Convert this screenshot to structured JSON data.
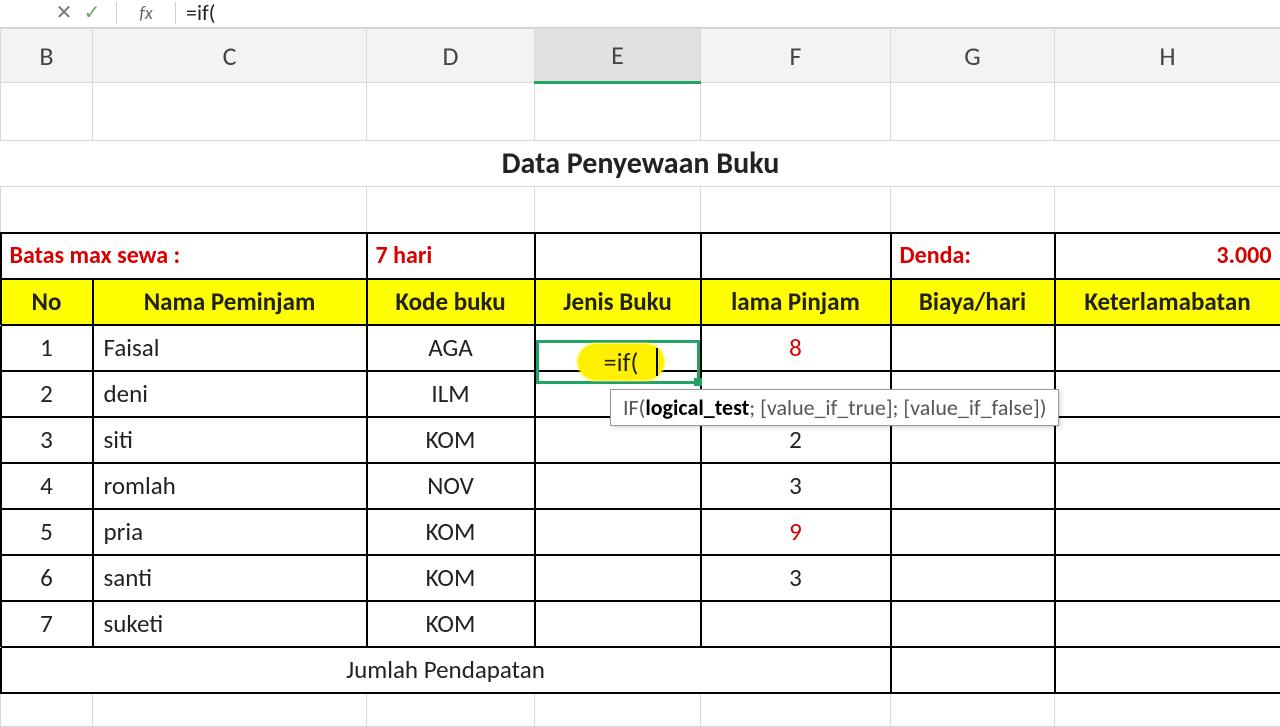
{
  "formula_bar": {
    "cancel_glyph": "✕",
    "accept_glyph": "✓",
    "fx_glyph": "fx",
    "formula_text": "=if("
  },
  "columns": {
    "B": "B",
    "C": "C",
    "D": "D",
    "E": "E",
    "F": "F",
    "G": "G",
    "H": "H"
  },
  "title": "Data Penyewaan Buku",
  "notice_row": {
    "label": "Batas max sewa :",
    "duration": "7 hari",
    "denda_label": "Denda:",
    "denda_value": "3.000"
  },
  "headers": {
    "no": "No",
    "nama": "Nama Peminjam",
    "kode": "Kode buku",
    "jenis": "Jenis Buku",
    "lama": "lama Pinjam",
    "biaya": "Biaya/hari",
    "telat": "Keterlamabatan"
  },
  "rows": [
    {
      "no": "1",
      "nama": "Faisal",
      "kode": "AGA",
      "lama": "8",
      "late": true
    },
    {
      "no": "2",
      "nama": "deni",
      "kode": "ILM",
      "lama": "",
      "late": false
    },
    {
      "no": "3",
      "nama": "siti",
      "kode": "KOM",
      "lama": "2",
      "late": false
    },
    {
      "no": "4",
      "nama": "romlah",
      "kode": "NOV",
      "lama": "3",
      "late": false
    },
    {
      "no": "5",
      "nama": "pria",
      "kode": "KOM",
      "lama": "9",
      "late": true
    },
    {
      "no": "6",
      "nama": "santi",
      "kode": "KOM",
      "lama": "3",
      "late": false
    },
    {
      "no": "7",
      "nama": "suketi",
      "kode": "KOM",
      "lama": "",
      "late": false
    }
  ],
  "footer": "Jumlah Pendapatan",
  "editing": {
    "text": "=if("
  },
  "tooltip": {
    "fn": "IF",
    "arg_bold": "logical_test",
    "rest": "; [value_if_true]; [value_if_false])"
  },
  "chart_data": {
    "type": "table",
    "title": "Data Penyewaan Buku",
    "columns": [
      "No",
      "Nama Peminjam",
      "Kode buku",
      "Jenis Buku",
      "lama Pinjam",
      "Biaya/hari",
      "Keterlamabatan"
    ],
    "rows": [
      [
        1,
        "Faisal",
        "AGA",
        null,
        8,
        null,
        null
      ],
      [
        2,
        "deni",
        "ILM",
        null,
        null,
        null,
        null
      ],
      [
        3,
        "siti",
        "KOM",
        null,
        2,
        null,
        null
      ],
      [
        4,
        "romlah",
        "NOV",
        null,
        3,
        null,
        null
      ],
      [
        5,
        "pria",
        "KOM",
        null,
        9,
        null,
        null
      ],
      [
        6,
        "santi",
        "KOM",
        null,
        3,
        null,
        null
      ],
      [
        7,
        "suketi",
        "KOM",
        null,
        null,
        null,
        null
      ]
    ],
    "parameters": {
      "Batas max sewa": "7 hari",
      "Denda": 3000
    }
  }
}
